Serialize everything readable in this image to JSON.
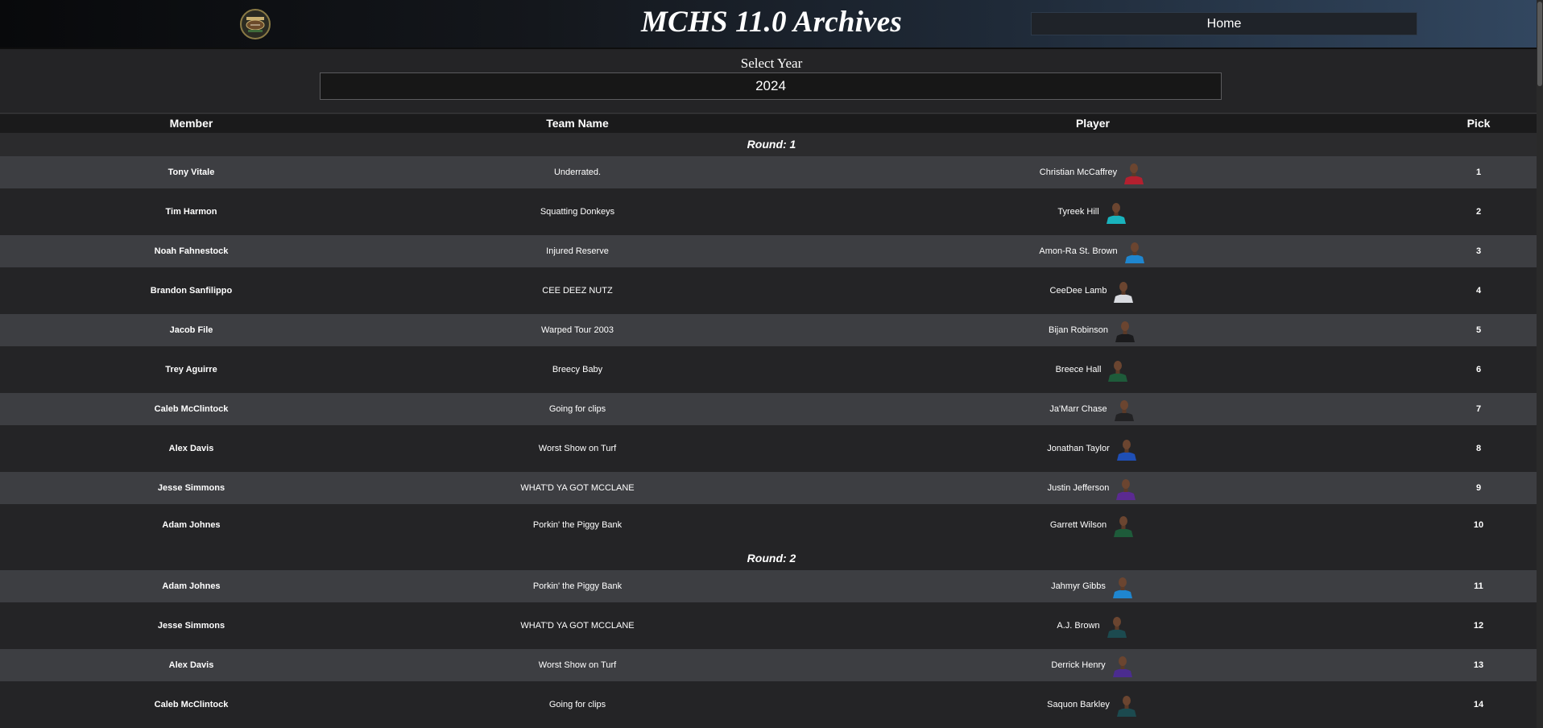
{
  "header": {
    "title": "MCHS 11.0 Archives",
    "home_label": "Home",
    "logo_icon": "mchs-logo-icon"
  },
  "year_selector": {
    "label": "Select Year",
    "selected": "2024"
  },
  "table": {
    "columns": [
      "Member",
      "Team Name",
      "Player",
      "Pick"
    ],
    "rounds": [
      {
        "label": "Round: 1",
        "picks": [
          {
            "member": "Tony Vitale",
            "team": "Underrated.",
            "player": "Christian McCaffrey",
            "pick": "1",
            "jersey": "#b3202f"
          },
          {
            "member": "Tim Harmon",
            "team": "Squatting Donkeys",
            "player": "Tyreek Hill",
            "pick": "2",
            "jersey": "#19b3bd"
          },
          {
            "member": "Noah Fahnestock",
            "team": "Injured Reserve",
            "player": "Amon-Ra St. Brown",
            "pick": "3",
            "jersey": "#1f86cf"
          },
          {
            "member": "Brandon Sanfilippo",
            "team": "CEE DEEZ NUTZ",
            "player": "CeeDee Lamb",
            "pick": "4",
            "jersey": "#d9dbe0"
          },
          {
            "member": "Jacob File",
            "team": "Warped Tour 2003",
            "player": "Bijan Robinson",
            "pick": "5",
            "jersey": "#1b1b1d"
          },
          {
            "member": "Trey Aguirre",
            "team": "Breecy Baby",
            "player": "Breece Hall",
            "pick": "6",
            "jersey": "#1e5b3a"
          },
          {
            "member": "Caleb McClintock",
            "team": "Going for clips",
            "player": "Ja'Marr Chase",
            "pick": "7",
            "jersey": "#222224"
          },
          {
            "member": "Alex Davis",
            "team": "Worst Show on Turf",
            "player": "Jonathan Taylor",
            "pick": "8",
            "jersey": "#1f4fb5"
          },
          {
            "member": "Jesse Simmons",
            "team": "WHAT'D YA GOT MCCLANE",
            "player": "Justin Jefferson",
            "pick": "9",
            "jersey": "#5b2a91"
          },
          {
            "member": "Adam Johnes",
            "team": "Porkin' the Piggy Bank",
            "player": "Garrett Wilson",
            "pick": "10",
            "jersey": "#1e5b3a"
          }
        ]
      },
      {
        "label": "Round: 2",
        "picks": [
          {
            "member": "Adam Johnes",
            "team": "Porkin' the Piggy Bank",
            "player": "Jahmyr Gibbs",
            "pick": "11",
            "jersey": "#1f86cf"
          },
          {
            "member": "Jesse Simmons",
            "team": "WHAT'D YA GOT MCCLANE",
            "player": "A.J. Brown",
            "pick": "12",
            "jersey": "#1c4a4f"
          },
          {
            "member": "Alex Davis",
            "team": "Worst Show on Turf",
            "player": "Derrick Henry",
            "pick": "13",
            "jersey": "#4b2c8f"
          },
          {
            "member": "Caleb McClintock",
            "team": "Going for clips",
            "player": "Saquon Barkley",
            "pick": "14",
            "jersey": "#1c4a4f"
          }
        ]
      }
    ]
  }
}
